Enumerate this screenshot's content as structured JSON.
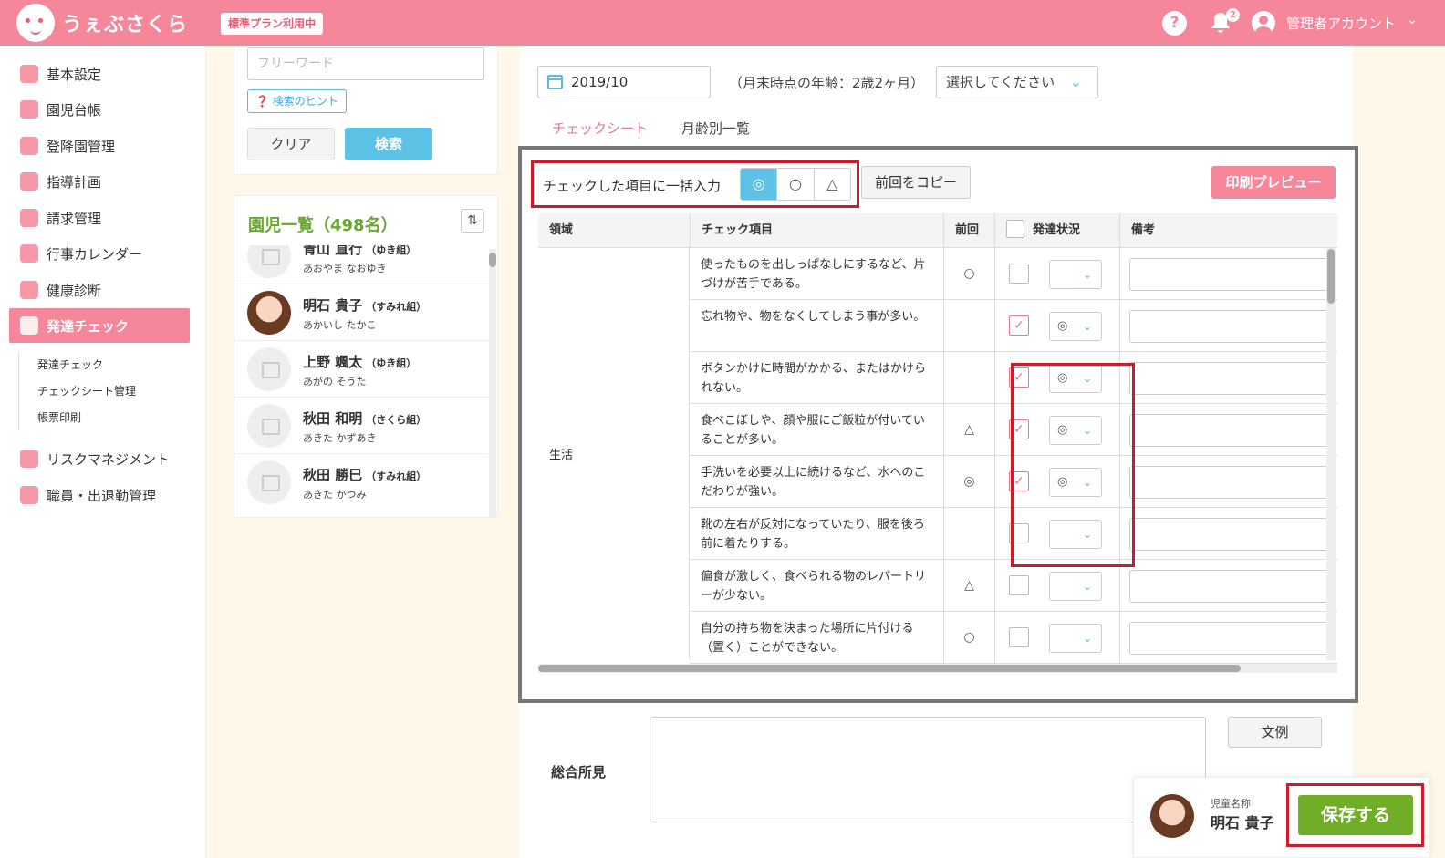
{
  "header": {
    "logo_text": "うぇぶさくら",
    "plan_badge": "標準プラン利用中",
    "help_icon": "?",
    "notification_count": "2",
    "account_label": "管理者アカウント",
    "chevron": "⌄"
  },
  "sidebar": {
    "items": [
      {
        "label": "基本設定",
        "icon": "gear-icon"
      },
      {
        "label": "園児台帳",
        "icon": "child-icon"
      },
      {
        "label": "登降園管理",
        "icon": "building-icon"
      },
      {
        "label": "指導計画",
        "icon": "notebook-icon"
      },
      {
        "label": "請求管理",
        "icon": "calculator-icon"
      },
      {
        "label": "行事カレンダー",
        "icon": "calendar-icon"
      },
      {
        "label": "健康診断",
        "icon": "stethoscope-icon"
      },
      {
        "label": "発達チェック",
        "icon": "checklist-icon"
      },
      {
        "label": "リスクマネジメント",
        "icon": "heart-hands-icon"
      },
      {
        "label": "職員・出退勤管理",
        "icon": "briefcase-icon"
      }
    ],
    "sub_items": [
      "発達チェック",
      "チェックシート管理",
      "帳票印刷"
    ]
  },
  "search": {
    "placeholder": "フリーワード",
    "hint_label": "検索のヒント",
    "clear_label": "クリア",
    "search_label": "検索"
  },
  "child_list": {
    "title": "園児一覧（498名）",
    "sort_icon": "⇅",
    "items": [
      {
        "name": "青山 直行",
        "class": "（ゆき組）",
        "kana": "あおやま なおゆき",
        "photo": false
      },
      {
        "name": "明石 貴子",
        "class": "（すみれ組）",
        "kana": "あかいし たかこ",
        "photo": true
      },
      {
        "name": "上野 颯太",
        "class": "（ゆき組）",
        "kana": "あがの そうた",
        "photo": false
      },
      {
        "name": "秋田 和明",
        "class": "（さくら組）",
        "kana": "あきた かずあき",
        "photo": false
      },
      {
        "name": "秋田 勝巳",
        "class": "（すみれ組）",
        "kana": "あきた かつみ",
        "photo": false
      }
    ]
  },
  "main": {
    "date_value": "2019/10",
    "age_text": "（月末時点の年齢：2歳2ヶ月）",
    "select_placeholder": "選択してください",
    "tabs": [
      "チェックシート",
      "月齢別一覧"
    ],
    "bulk_label": "チェックした項目に一括入力",
    "marks": [
      "◎",
      "○",
      "△"
    ],
    "copy_label": "前回をコピー",
    "print_label": "印刷プレビュー",
    "table": {
      "headers": [
        "領域",
        "チェック項目",
        "前回",
        "発達状況",
        "備考"
      ],
      "domain": "生活",
      "rows": [
        {
          "item": "使ったものを出しっぱなしにするなど、片づけが苦手である。",
          "prev": "○",
          "checked": false,
          "status": ""
        },
        {
          "item": "忘れ物や、物をなくしてしまう事が多い。",
          "prev": "",
          "checked": true,
          "status": "◎"
        },
        {
          "item": "ボタンかけに時間がかかる、またはかけられない。",
          "prev": "",
          "checked": true,
          "status": "◎"
        },
        {
          "item": "食べこぼしや、顔や服にご飯粒が付いていることが多い。",
          "prev": "△",
          "checked": true,
          "status": "◎"
        },
        {
          "item": "手洗いを必要以上に続けるなど、水へのこだわりが強い。",
          "prev": "◎",
          "checked": true,
          "status": "◎"
        },
        {
          "item": "靴の左右が反対になっていたり、服を後ろ前に着たりする。",
          "prev": "",
          "checked": false,
          "status": ""
        },
        {
          "item": "偏食が激しく、食べられる物のレパートリーが少ない。",
          "prev": "△",
          "checked": false,
          "status": ""
        },
        {
          "item": "自分の持ち物を決まった場所に片付ける（置く）ことができない。",
          "prev": "○",
          "checked": false,
          "status": ""
        }
      ]
    },
    "sogo_label": "総合所見",
    "example_label": "文例"
  },
  "save_panel": {
    "caption": "児童名称",
    "child_name": "明石 貴子",
    "save_label": "保存する"
  }
}
